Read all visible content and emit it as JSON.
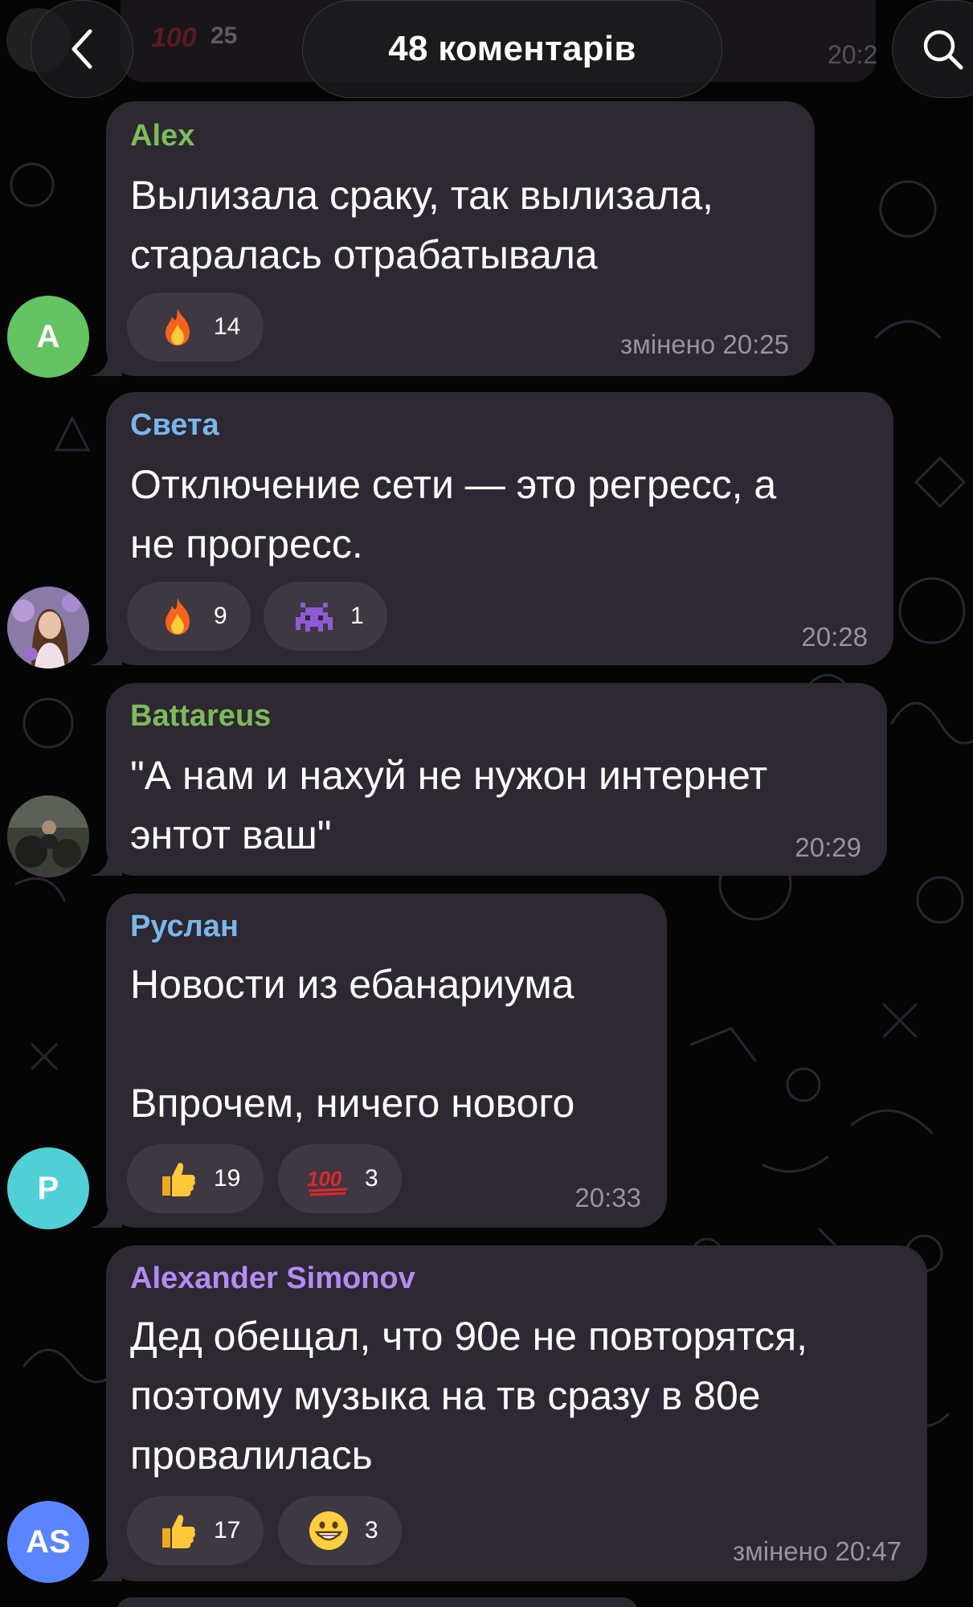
{
  "header": {
    "title": "48 коментарів",
    "back_icon": "chevron-left-icon",
    "search_icon": "search-icon",
    "previous_message": {
      "reaction_count": "25",
      "time": "20:2"
    }
  },
  "colors": {
    "bubble": "#2d2832",
    "name_green": "#7dbb58",
    "name_blue": "#79b6ea",
    "name_purple": "#b38cf5",
    "avatar_green": "#64c362",
    "avatar_cyan": "#4fd0d6",
    "avatar_blue": "#5b84ff"
  },
  "messages": [
    {
      "author": "Alex",
      "lines": [
        "Вылизала сраку, так вылизала,",
        "старалась отрабатывала"
      ],
      "reactions": [
        {
          "emoji": "fire",
          "count": "14"
        }
      ],
      "time": "змінено 20:25",
      "avatar": {
        "initials": "A"
      }
    },
    {
      "author": "Света",
      "lines": [
        "Отключение сети — это регресс, а",
        "не прогресс."
      ],
      "reactions": [
        {
          "emoji": "fire",
          "count": "9"
        },
        {
          "emoji": "space-invader",
          "count": "1"
        }
      ],
      "time": "20:28",
      "avatar": {
        "initials": ""
      }
    },
    {
      "author": "Battareus",
      "lines": [
        "\"А нам и нахуй не нужон интернет",
        "энтот ваш\""
      ],
      "reactions": [],
      "time": "20:29",
      "avatar": {
        "initials": ""
      }
    },
    {
      "author": "Руслан",
      "lines": [
        "Новости из ебанариума",
        "",
        "Впрочем, ничего нового"
      ],
      "reactions": [
        {
          "emoji": "thumbs-up",
          "count": "19"
        },
        {
          "emoji": "hundred-points",
          "count": "3"
        }
      ],
      "time": "20:33",
      "avatar": {
        "initials": "P"
      }
    },
    {
      "author": "Alexander Simonov",
      "lines": [
        "Дед обещал, что 90е не повторятся,",
        "поэтому музыка на тв сразу в 80е",
        "провалилась"
      ],
      "reactions": [
        {
          "emoji": "thumbs-up",
          "count": "17"
        },
        {
          "emoji": "grinning-face",
          "count": "3"
        }
      ],
      "time": "змінено 20:47",
      "avatar": {
        "initials": "AS"
      }
    }
  ]
}
